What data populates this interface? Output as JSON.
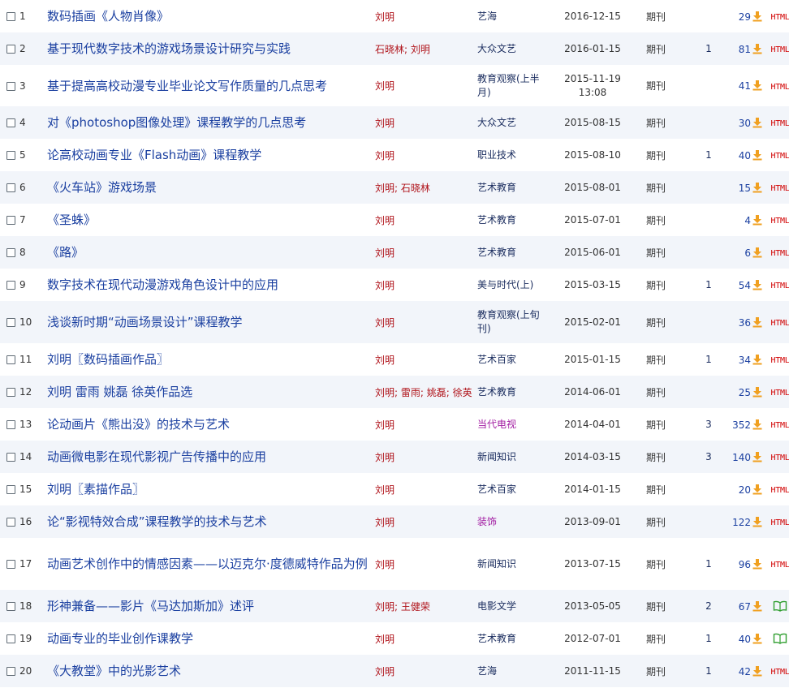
{
  "rows": [
    {
      "index": "1",
      "title": "数码插画《人物肖像》",
      "authors": [
        "刘明"
      ],
      "source": "艺海",
      "date": [
        "2016-12-15"
      ],
      "type": "期刊",
      "citations": "",
      "downloads": "29",
      "fmt": "html",
      "h": 40
    },
    {
      "index": "2",
      "title": "基于现代数字技术的游戏场景设计研究与实践",
      "authors": [
        "石晓林",
        "刘明"
      ],
      "source": "大众文艺",
      "date": [
        "2016-01-15"
      ],
      "type": "期刊",
      "citations": "1",
      "downloads": "81",
      "fmt": "html",
      "h": 40
    },
    {
      "index": "3",
      "title": "基于提高高校动漫专业毕业论文写作质量的几点思考",
      "authors": [
        "刘明"
      ],
      "source": "教育观察(上半月)",
      "date": [
        "2015-11-19",
        "13:08"
      ],
      "type": "期刊",
      "citations": "",
      "downloads": "41",
      "fmt": "html",
      "h": 51
    },
    {
      "index": "4",
      "title": "对《photoshop图像处理》课程教学的几点思考",
      "authors": [
        "刘明"
      ],
      "source": "大众文艺",
      "date": [
        "2015-08-15"
      ],
      "type": "期刊",
      "citations": "",
      "downloads": "30",
      "fmt": "html",
      "h": 40
    },
    {
      "index": "5",
      "title": "论高校动画专业《Flash动画》课程教学",
      "authors": [
        "刘明"
      ],
      "source": "职业技术",
      "date": [
        "2015-08-10"
      ],
      "type": "期刊",
      "citations": "1",
      "downloads": "40",
      "fmt": "html",
      "h": 40
    },
    {
      "index": "6",
      "title": "《火车站》游戏场景",
      "authors": [
        "刘明",
        "石晓林"
      ],
      "source": "艺术教育",
      "date": [
        "2015-08-01"
      ],
      "type": "期刊",
      "citations": "",
      "downloads": "15",
      "fmt": "html",
      "h": 40
    },
    {
      "index": "7",
      "title": "《圣蛛》",
      "authors": [
        "刘明"
      ],
      "source": "艺术教育",
      "date": [
        "2015-07-01"
      ],
      "type": "期刊",
      "citations": "",
      "downloads": "4",
      "fmt": "html",
      "h": 40
    },
    {
      "index": "8",
      "title": "《路》",
      "authors": [
        "刘明"
      ],
      "source": "艺术教育",
      "date": [
        "2015-06-01"
      ],
      "type": "期刊",
      "citations": "",
      "downloads": "6",
      "fmt": "html",
      "h": 40
    },
    {
      "index": "9",
      "title": "数字技术在现代动漫游戏角色设计中的应用",
      "authors": [
        "刘明"
      ],
      "source": "美与时代(上)",
      "date": [
        "2015-03-15"
      ],
      "type": "期刊",
      "citations": "1",
      "downloads": "54",
      "fmt": "html",
      "h": 40
    },
    {
      "index": "10",
      "title": "浅谈新时期“动画场景设计”课程教学",
      "authors": [
        "刘明"
      ],
      "source": "教育观察(上旬刊)",
      "date": [
        "2015-02-01"
      ],
      "type": "期刊",
      "citations": "",
      "downloads": "36",
      "fmt": "html",
      "h": 52
    },
    {
      "index": "11",
      "title": "刘明〖数码插画作品〗",
      "authors": [
        "刘明"
      ],
      "source": "艺术百家",
      "date": [
        "2015-01-15"
      ],
      "type": "期刊",
      "citations": "1",
      "downloads": "34",
      "fmt": "html",
      "h": 40
    },
    {
      "index": "12",
      "title": "刘明 雷雨 姚磊 徐英作品选",
      "authors": [
        "刘明",
        "雷雨",
        "姚磊",
        "徐英"
      ],
      "source": "艺术教育",
      "date": [
        "2014-06-01"
      ],
      "type": "期刊",
      "citations": "",
      "downloads": "25",
      "fmt": "html",
      "h": 40
    },
    {
      "index": "13",
      "title": "论动画片《熊出没》的技术与艺术",
      "authors": [
        "刘明"
      ],
      "source": "当代电视",
      "sourceColor": "purple",
      "date": [
        "2014-04-01"
      ],
      "type": "期刊",
      "citations": "3",
      "downloads": "352",
      "fmt": "html",
      "h": 40
    },
    {
      "index": "14",
      "title": "动画微电影在现代影视广告传播中的应用",
      "authors": [
        "刘明"
      ],
      "source": "新闻知识",
      "date": [
        "2014-03-15"
      ],
      "type": "期刊",
      "citations": "3",
      "downloads": "140",
      "fmt": "html",
      "h": 40
    },
    {
      "index": "15",
      "title": "刘明〖素描作品〗",
      "authors": [
        "刘明"
      ],
      "source": "艺术百家",
      "date": [
        "2014-01-15"
      ],
      "type": "期刊",
      "citations": "",
      "downloads": "20",
      "fmt": "html",
      "h": 40
    },
    {
      "index": "16",
      "title": "论“影视特效合成”课程教学的技术与艺术",
      "authors": [
        "刘明"
      ],
      "source": "装饰",
      "sourceColor": "purple",
      "date": [
        "2013-09-01"
      ],
      "type": "期刊",
      "citations": "",
      "downloads": "122",
      "fmt": "html",
      "h": 40
    },
    {
      "index": "17",
      "title": "动画艺术创作中的情感因素——以迈克尔·度德威特作品为例",
      "authors": [
        "刘明"
      ],
      "source": "新闻知识",
      "date": [
        "2013-07-15"
      ],
      "type": "期刊",
      "citations": "1",
      "downloads": "96",
      "fmt": "html",
      "h": 64
    },
    {
      "index": "18",
      "title": "形神兼备——影片《马达加斯加》述评",
      "authors": [
        "刘明",
        "王健荣"
      ],
      "source": "电影文学",
      "date": [
        "2013-05-05"
      ],
      "type": "期刊",
      "citations": "2",
      "downloads": "67",
      "fmt": "read",
      "h": 40
    },
    {
      "index": "19",
      "title": "动画专业的毕业创作课教学",
      "authors": [
        "刘明"
      ],
      "source": "艺术教育",
      "date": [
        "2012-07-01"
      ],
      "type": "期刊",
      "citations": "1",
      "downloads": "40",
      "fmt": "read",
      "h": 40
    },
    {
      "index": "20",
      "title": "《大教堂》中的光影艺术",
      "authors": [
        "刘明"
      ],
      "source": "艺海",
      "date": [
        "2011-11-15"
      ],
      "type": "期刊",
      "citations": "1",
      "downloads": "42",
      "fmt": "html",
      "h": 40
    }
  ],
  "html_label": "HTML",
  "author_separator": "; ",
  "colors": {
    "title": "#1a3fa0",
    "author": "#b0141b",
    "purple_source": "#a21ca2",
    "html": "#d10000",
    "download_icon": "#f0a020",
    "read_icon": "#2f9e2f"
  }
}
